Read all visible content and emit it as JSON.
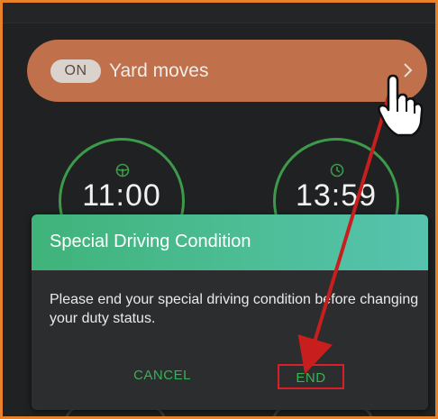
{
  "special_condition": {
    "toggle_state": "ON",
    "label": "Yard moves"
  },
  "timers": {
    "drive_time": "11:00",
    "shift_time": "13:59"
  },
  "dialog": {
    "title": "Special Driving Condition",
    "message": "Please end your special driving condition before changing your duty status.",
    "cancel_label": "CANCEL",
    "end_label": "END"
  },
  "colors": {
    "frame_border": "#e8822a",
    "pill_background": "#c0704a",
    "gauge_green": "#3d9a4a",
    "button_green": "#38b255",
    "highlight_red": "#d82028"
  },
  "icons": {
    "chevron": "chevron-right-icon",
    "steering": "steering-wheel-icon",
    "clock": "clock-icon",
    "pointer": "hand-pointer-icon"
  }
}
